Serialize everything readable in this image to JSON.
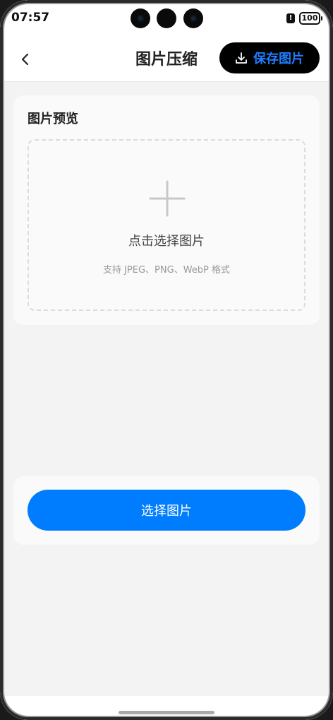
{
  "status_bar": {
    "time": "07:57",
    "alert_glyph": "!",
    "battery": "100"
  },
  "header": {
    "back_icon": "chevron-left-icon",
    "title": "图片压缩",
    "save_icon": "download-icon",
    "save_label": "保存图片"
  },
  "preview": {
    "title": "图片预览",
    "plus_icon": "plus-icon",
    "upload_title": "点击选择图片",
    "upload_hint": "支持 JPEG、PNG、WebP 格式"
  },
  "actions": {
    "select_label": "选择图片"
  },
  "colors": {
    "primary": "#007dff",
    "save_text": "#1e7fff",
    "save_bg": "#000000",
    "page_bg": "#f3f3f3"
  }
}
